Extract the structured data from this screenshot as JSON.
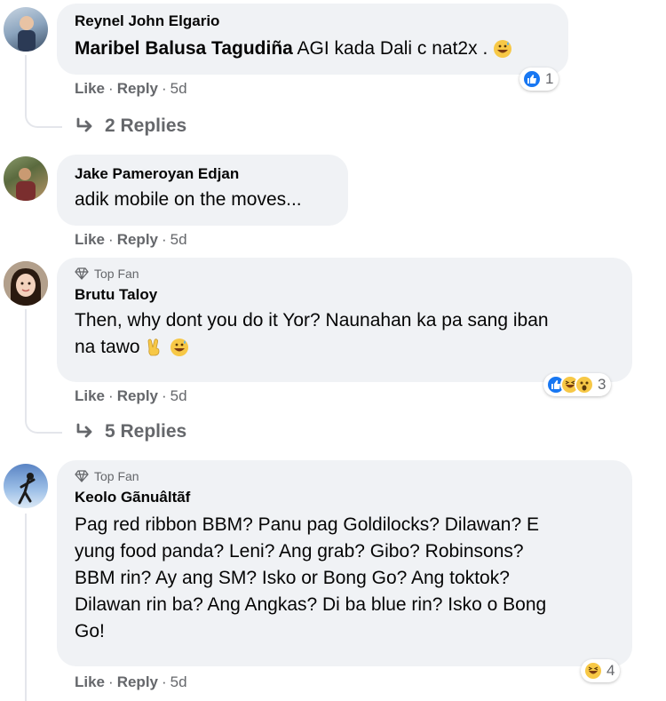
{
  "comments": [
    {
      "author": "Reynel John Elgario",
      "mention": "Maribel Balusa Tagudiña",
      "text": "AGI kada Dali c nat2x .",
      "actions": {
        "like": "Like",
        "reply": "Reply",
        "time": "5d"
      },
      "reaction_count": "1",
      "reaction_icons": [
        "like-icon"
      ],
      "replies_label": "2 Replies"
    },
    {
      "author": "Jake Pameroyan Edjan",
      "text": "adik mobile on the moves...",
      "actions": {
        "like": "Like",
        "reply": "Reply",
        "time": "5d"
      }
    },
    {
      "badge": "Top Fan",
      "author": "Brutu Taloy",
      "text_line1": "Then, why dont you do it Yor? Naunahan ka pa sang iban",
      "text_line2": "na tawo",
      "actions": {
        "like": "Like",
        "reply": "Reply",
        "time": "5d"
      },
      "reaction_count": "3",
      "reaction_icons": [
        "like-icon",
        "haha-icon",
        "wow-icon"
      ],
      "replies_label": "5 Replies"
    },
    {
      "badge": "Top Fan",
      "author": "Keolo Gãnuâltãf",
      "text_lines": [
        "Pag red ribbon BBM? Panu pag Goldilocks? Dilawan? E",
        "yung food panda? Leni? Ang grab? Gibo? Robinsons?",
        "BBM rin? Ay ang SM? Isko or Bong Go? Ang toktok?",
        "Dilawan rin ba? Ang Angkas? Di ba blue rin? Isko o Bong",
        "Go!"
      ],
      "actions": {
        "like": "Like",
        "reply": "Reply",
        "time": "5d"
      },
      "reaction_count": "4",
      "reaction_icons": [
        "haha-icon"
      ]
    }
  ],
  "separator": "·",
  "colors": {
    "bubble": "#f0f2f5",
    "meta": "#65676b",
    "text": "#050505",
    "like_blue": "#1877f2"
  }
}
